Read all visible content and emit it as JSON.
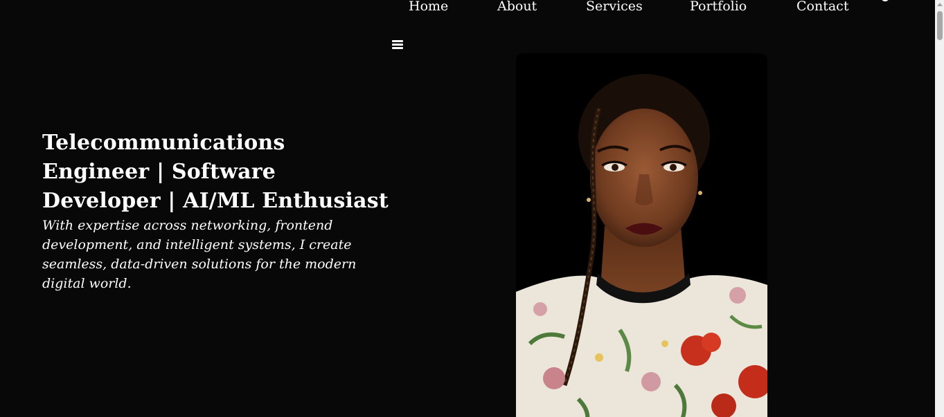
{
  "nav": {
    "items": [
      {
        "label": "Home"
      },
      {
        "label": "About"
      },
      {
        "label": "Services"
      },
      {
        "label": "Portfolio"
      },
      {
        "label": "Contact"
      }
    ],
    "menu_icon": "hamburger-menu-icon"
  },
  "hero": {
    "title": "Telecommunications Engineer | Software Developer | AI/ML Enthusiast",
    "subtitle": "With expertise across networking, frontend development, and intelligent systems, I create seamless, data-driven solutions for the modern digital world."
  },
  "colors": {
    "background": "#080808",
    "text": "#ffffff",
    "scrollbar_track": "#f1f1f1",
    "scrollbar_thumb": "#a8a8a8"
  }
}
